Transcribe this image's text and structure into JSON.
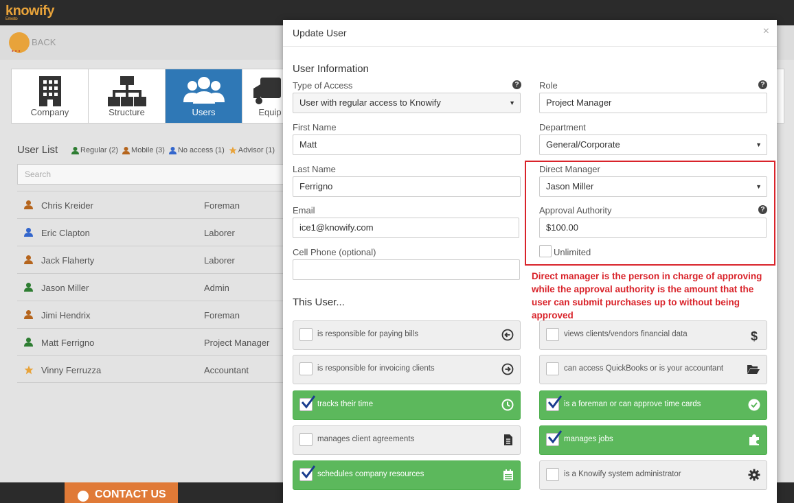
{
  "app": {
    "logo": "knowify",
    "logo_sub": "Ernesto",
    "back_label": "BACK"
  },
  "tabs": [
    {
      "label": "Company",
      "icon": "building-icon"
    },
    {
      "label": "Structure",
      "icon": "org-chart-icon"
    },
    {
      "label": "Users",
      "icon": "users-icon",
      "active": true
    },
    {
      "label": "Equip",
      "icon": "truck-icon"
    }
  ],
  "user_list": {
    "title": "User List",
    "legend": [
      {
        "label": "Regular (2)",
        "color": "#2e7d32"
      },
      {
        "label": "Mobile (3)",
        "color": "#b5651d"
      },
      {
        "label": "No access (1)",
        "color": "#3366cc"
      },
      {
        "label": "Advisor (1)",
        "color": "#e8a33a"
      }
    ],
    "search_placeholder": "Search",
    "rows": [
      {
        "name": "Chris Kreider",
        "role": "Foreman",
        "color": "#b5651d"
      },
      {
        "name": "Eric Clapton",
        "role": "Laborer",
        "color": "#3366cc"
      },
      {
        "name": "Jack Flaherty",
        "role": "Laborer",
        "color": "#b5651d"
      },
      {
        "name": "Jason Miller",
        "role": "Admin",
        "color": "#2e7d32"
      },
      {
        "name": "Jimi Hendrix",
        "role": "Foreman",
        "color": "#b5651d"
      },
      {
        "name": "Matt Ferrigno",
        "role": "Project Manager",
        "color": "#2e7d32"
      },
      {
        "name": "Vinny Ferruzza",
        "role": "Accountant",
        "color": "#e8a33a"
      }
    ]
  },
  "footer": {
    "contact_label": "CONTACT US"
  },
  "modal": {
    "title": "Update User",
    "close": "×",
    "section_user_info": "User Information",
    "type_of_access": {
      "label": "Type of Access",
      "value": "User with regular access to Knowify"
    },
    "role": {
      "label": "Role",
      "value": "Project Manager"
    },
    "first_name": {
      "label": "First Name",
      "value": "Matt"
    },
    "department": {
      "label": "Department",
      "value": "General/Corporate"
    },
    "last_name": {
      "label": "Last Name",
      "value": "Ferrigno"
    },
    "direct_manager": {
      "label": "Direct Manager",
      "value": "Jason Miller"
    },
    "email": {
      "label": "Email",
      "value": "ice1@knowify.com"
    },
    "approval_authority": {
      "label": "Approval Authority",
      "value": "$100.00"
    },
    "unlimited_label": "Unlimited",
    "cell_phone": {
      "label": "Cell Phone (optional)",
      "value": ""
    },
    "annotation": "Direct manager is the person in charge of approving while the approval authority is the amount that the user can submit purchases up to without being approved",
    "section_this_user": "This User...",
    "permissions": [
      {
        "label": "is responsible for paying bills",
        "checked": false,
        "icon": "arrow-left-circle-icon"
      },
      {
        "label": "views clients/vendors financial data",
        "checked": false,
        "icon": "dollar-icon"
      },
      {
        "label": "is responsible for invoicing clients",
        "checked": false,
        "icon": "arrow-right-circle-icon"
      },
      {
        "label": "can access QuickBooks or is your accountant",
        "checked": false,
        "icon": "folder-open-icon"
      },
      {
        "label": "tracks their time",
        "checked": true,
        "icon": "clock-icon"
      },
      {
        "label": "is a foreman or can approve time cards",
        "checked": true,
        "icon": "check-circle-icon"
      },
      {
        "label": "manages client agreements",
        "checked": false,
        "icon": "document-icon"
      },
      {
        "label": "manages jobs",
        "checked": true,
        "icon": "puzzle-icon"
      },
      {
        "label": "schedules company resources",
        "checked": true,
        "icon": "calendar-icon"
      },
      {
        "label": "is a Knowify system administrator",
        "checked": false,
        "icon": "gear-icon"
      }
    ]
  },
  "colors": {
    "active_tab": "#2f78b6",
    "green": "#5cb85c",
    "annotation_red": "#d9232a",
    "contact_orange": "#e07a37"
  }
}
